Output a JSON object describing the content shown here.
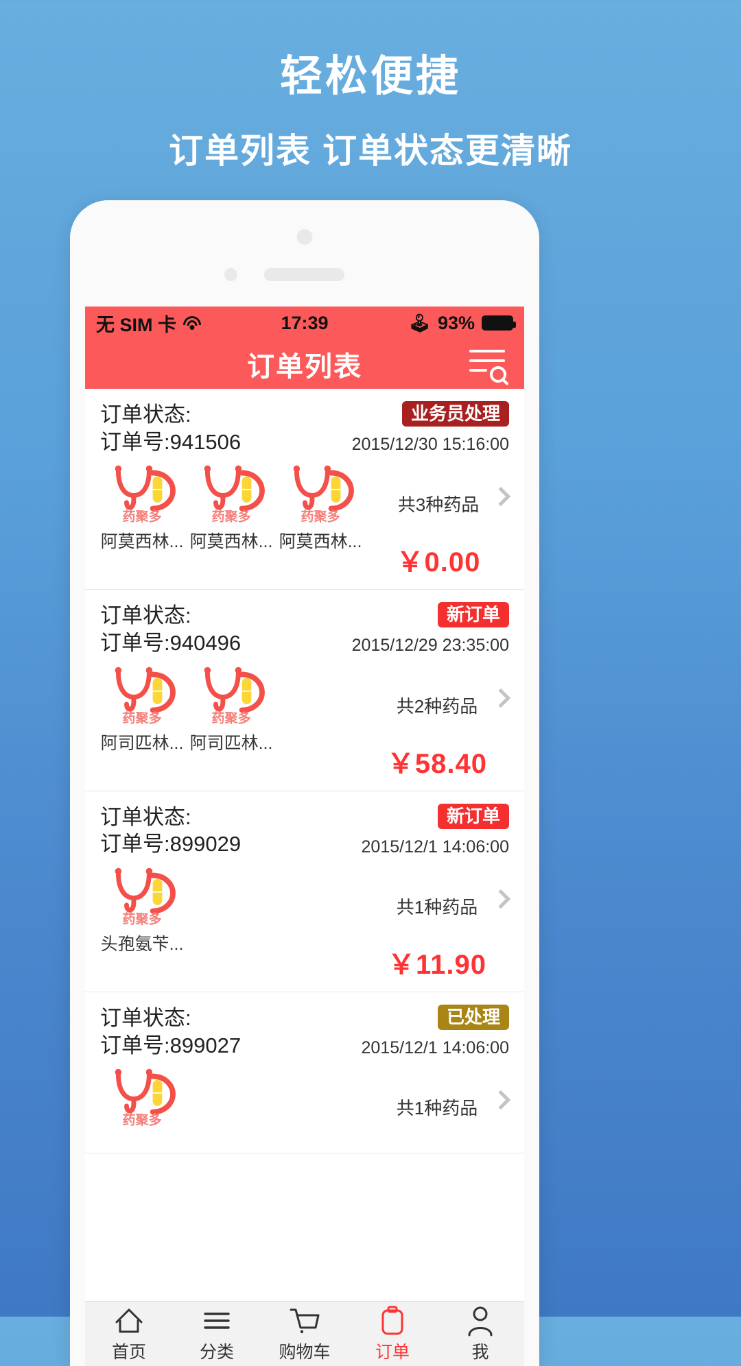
{
  "promo": {
    "headline": "轻松便捷",
    "subline": "订单列表  订单状态更清晰"
  },
  "colors": {
    "accent_red": "#fc5a5a",
    "price_red": "#ff3333",
    "badge_handler": "#a82020",
    "badge_new": "#f42f2f",
    "badge_done": "#a98516",
    "page_bg_top": "#68aede",
    "page_bg_bottom": "#3f79c4"
  },
  "statusbar": {
    "carrier": "无 SIM 卡",
    "wifi_icon": "wifi-icon",
    "time": "17:39",
    "bluetooth_icon": "bluetooth-icon",
    "battery_percent": "93%",
    "battery_icon": "battery-full-icon"
  },
  "navbar": {
    "title": "订单列表",
    "search_icon": "list-search-icon"
  },
  "order_labels": {
    "status_label": "订单状态:",
    "order_no_prefix": "订单号:"
  },
  "orders": [
    {
      "order_no": "941506",
      "badge": "业务员处理",
      "badge_type": "handler",
      "date": "2015/12/30 15:16:00",
      "count_text": "共3种药品",
      "price": "￥0.00",
      "goods": [
        {
          "name": "阿莫西林..."
        },
        {
          "name": "阿莫西林..."
        },
        {
          "name": "阿莫西林..."
        }
      ]
    },
    {
      "order_no": "940496",
      "badge": "新订单",
      "badge_type": "new",
      "date": "2015/12/29 23:35:00",
      "count_text": "共2种药品",
      "price": "￥58.40",
      "goods": [
        {
          "name": "阿司匹林..."
        },
        {
          "name": "阿司匹林..."
        }
      ]
    },
    {
      "order_no": "899029",
      "badge": "新订单",
      "badge_type": "new",
      "date": "2015/12/1 14:06:00",
      "count_text": "共1种药品",
      "price": "￥11.90",
      "goods": [
        {
          "name": "头孢氨苄..."
        }
      ]
    },
    {
      "order_no": "899027",
      "badge": "已处理",
      "badge_type": "done",
      "date": "2015/12/1 14:06:00",
      "count_text": "共1种药品",
      "price": "",
      "goods": [
        {
          "name": ""
        }
      ]
    }
  ],
  "brand_logo_text": "药聚多",
  "tabbar": {
    "items": [
      {
        "label": "首页",
        "icon": "home-icon",
        "active": false
      },
      {
        "label": "分类",
        "icon": "menu-lines-icon",
        "active": false
      },
      {
        "label": "购物车",
        "icon": "cart-icon",
        "active": false
      },
      {
        "label": "订单",
        "icon": "order-icon",
        "active": true
      },
      {
        "label": "我",
        "icon": "person-icon",
        "active": false
      }
    ]
  }
}
